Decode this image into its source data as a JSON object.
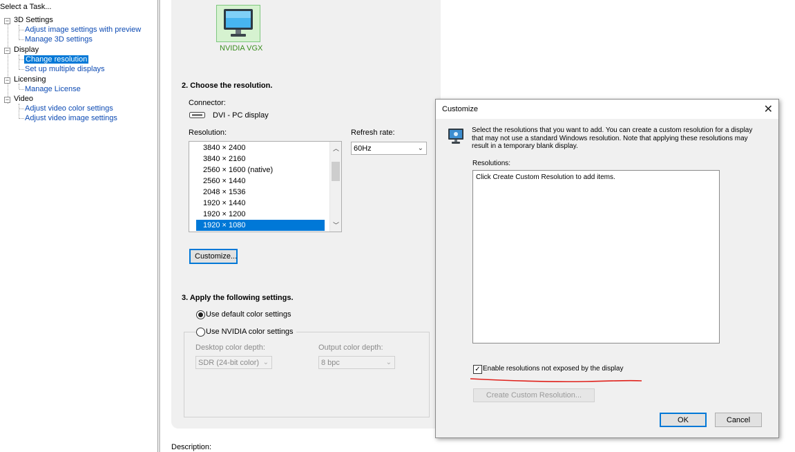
{
  "left_pane": {
    "title": "Select a Task...",
    "categories": [
      {
        "label": "3D Settings",
        "children": [
          "Adjust image settings with preview",
          "Manage 3D settings"
        ]
      },
      {
        "label": "Display",
        "children": [
          "Change resolution",
          "Set up multiple displays"
        ]
      },
      {
        "label": "Licensing",
        "children": [
          "Manage License"
        ]
      },
      {
        "label": "Video",
        "children": [
          "Adjust video color settings",
          "Adjust video image settings"
        ]
      }
    ],
    "selected": "Change resolution"
  },
  "main": {
    "display_name": "NVIDIA VGX",
    "section2_title": "2. Choose the resolution.",
    "connector_label": "Connector:",
    "connector_value": "DVI - PC display",
    "resolution_label": "Resolution:",
    "resolutions": [
      "3840 × 2400",
      "3840 × 2160",
      "2560 × 1600 (native)",
      "2560 × 1440",
      "2048 × 1536",
      "1920 × 1440",
      "1920 × 1200",
      "1920 × 1080"
    ],
    "selected_resolution": "1920 × 1080",
    "refresh_label": "Refresh rate:",
    "refresh_value": "60Hz",
    "customize_button": "Customize...",
    "section3_title": "3. Apply the following settings.",
    "radio_default": "Use default color settings",
    "radio_nvidia": "Use NVIDIA color settings",
    "desktop_depth_label": "Desktop color depth:",
    "desktop_depth_value": "SDR (24-bit color)",
    "output_depth_label": "Output color depth:",
    "output_depth_value": "8 bpc",
    "description_label": "Description:"
  },
  "dialog": {
    "title": "Customize",
    "close_glyph": "✕",
    "intro": "Select the resolutions that you want to add. You can create a custom resolution for a display that may not use a standard Windows resolution. Note that applying these resolutions may result in a temporary blank display.",
    "resolutions_label": "Resolutions:",
    "list_hint": "Click Create Custom Resolution to add items.",
    "checkbox_label": "Enable resolutions not exposed by the display",
    "checkbox_checked": true,
    "create_button": "Create Custom Resolution...",
    "ok_button": "OK",
    "cancel_button": "Cancel"
  },
  "colors": {
    "selection_blue": "#0078d7",
    "link_blue": "#0c4ab3",
    "nvidia_green": "#3a8d1e",
    "annotation_red": "#e0201a"
  }
}
